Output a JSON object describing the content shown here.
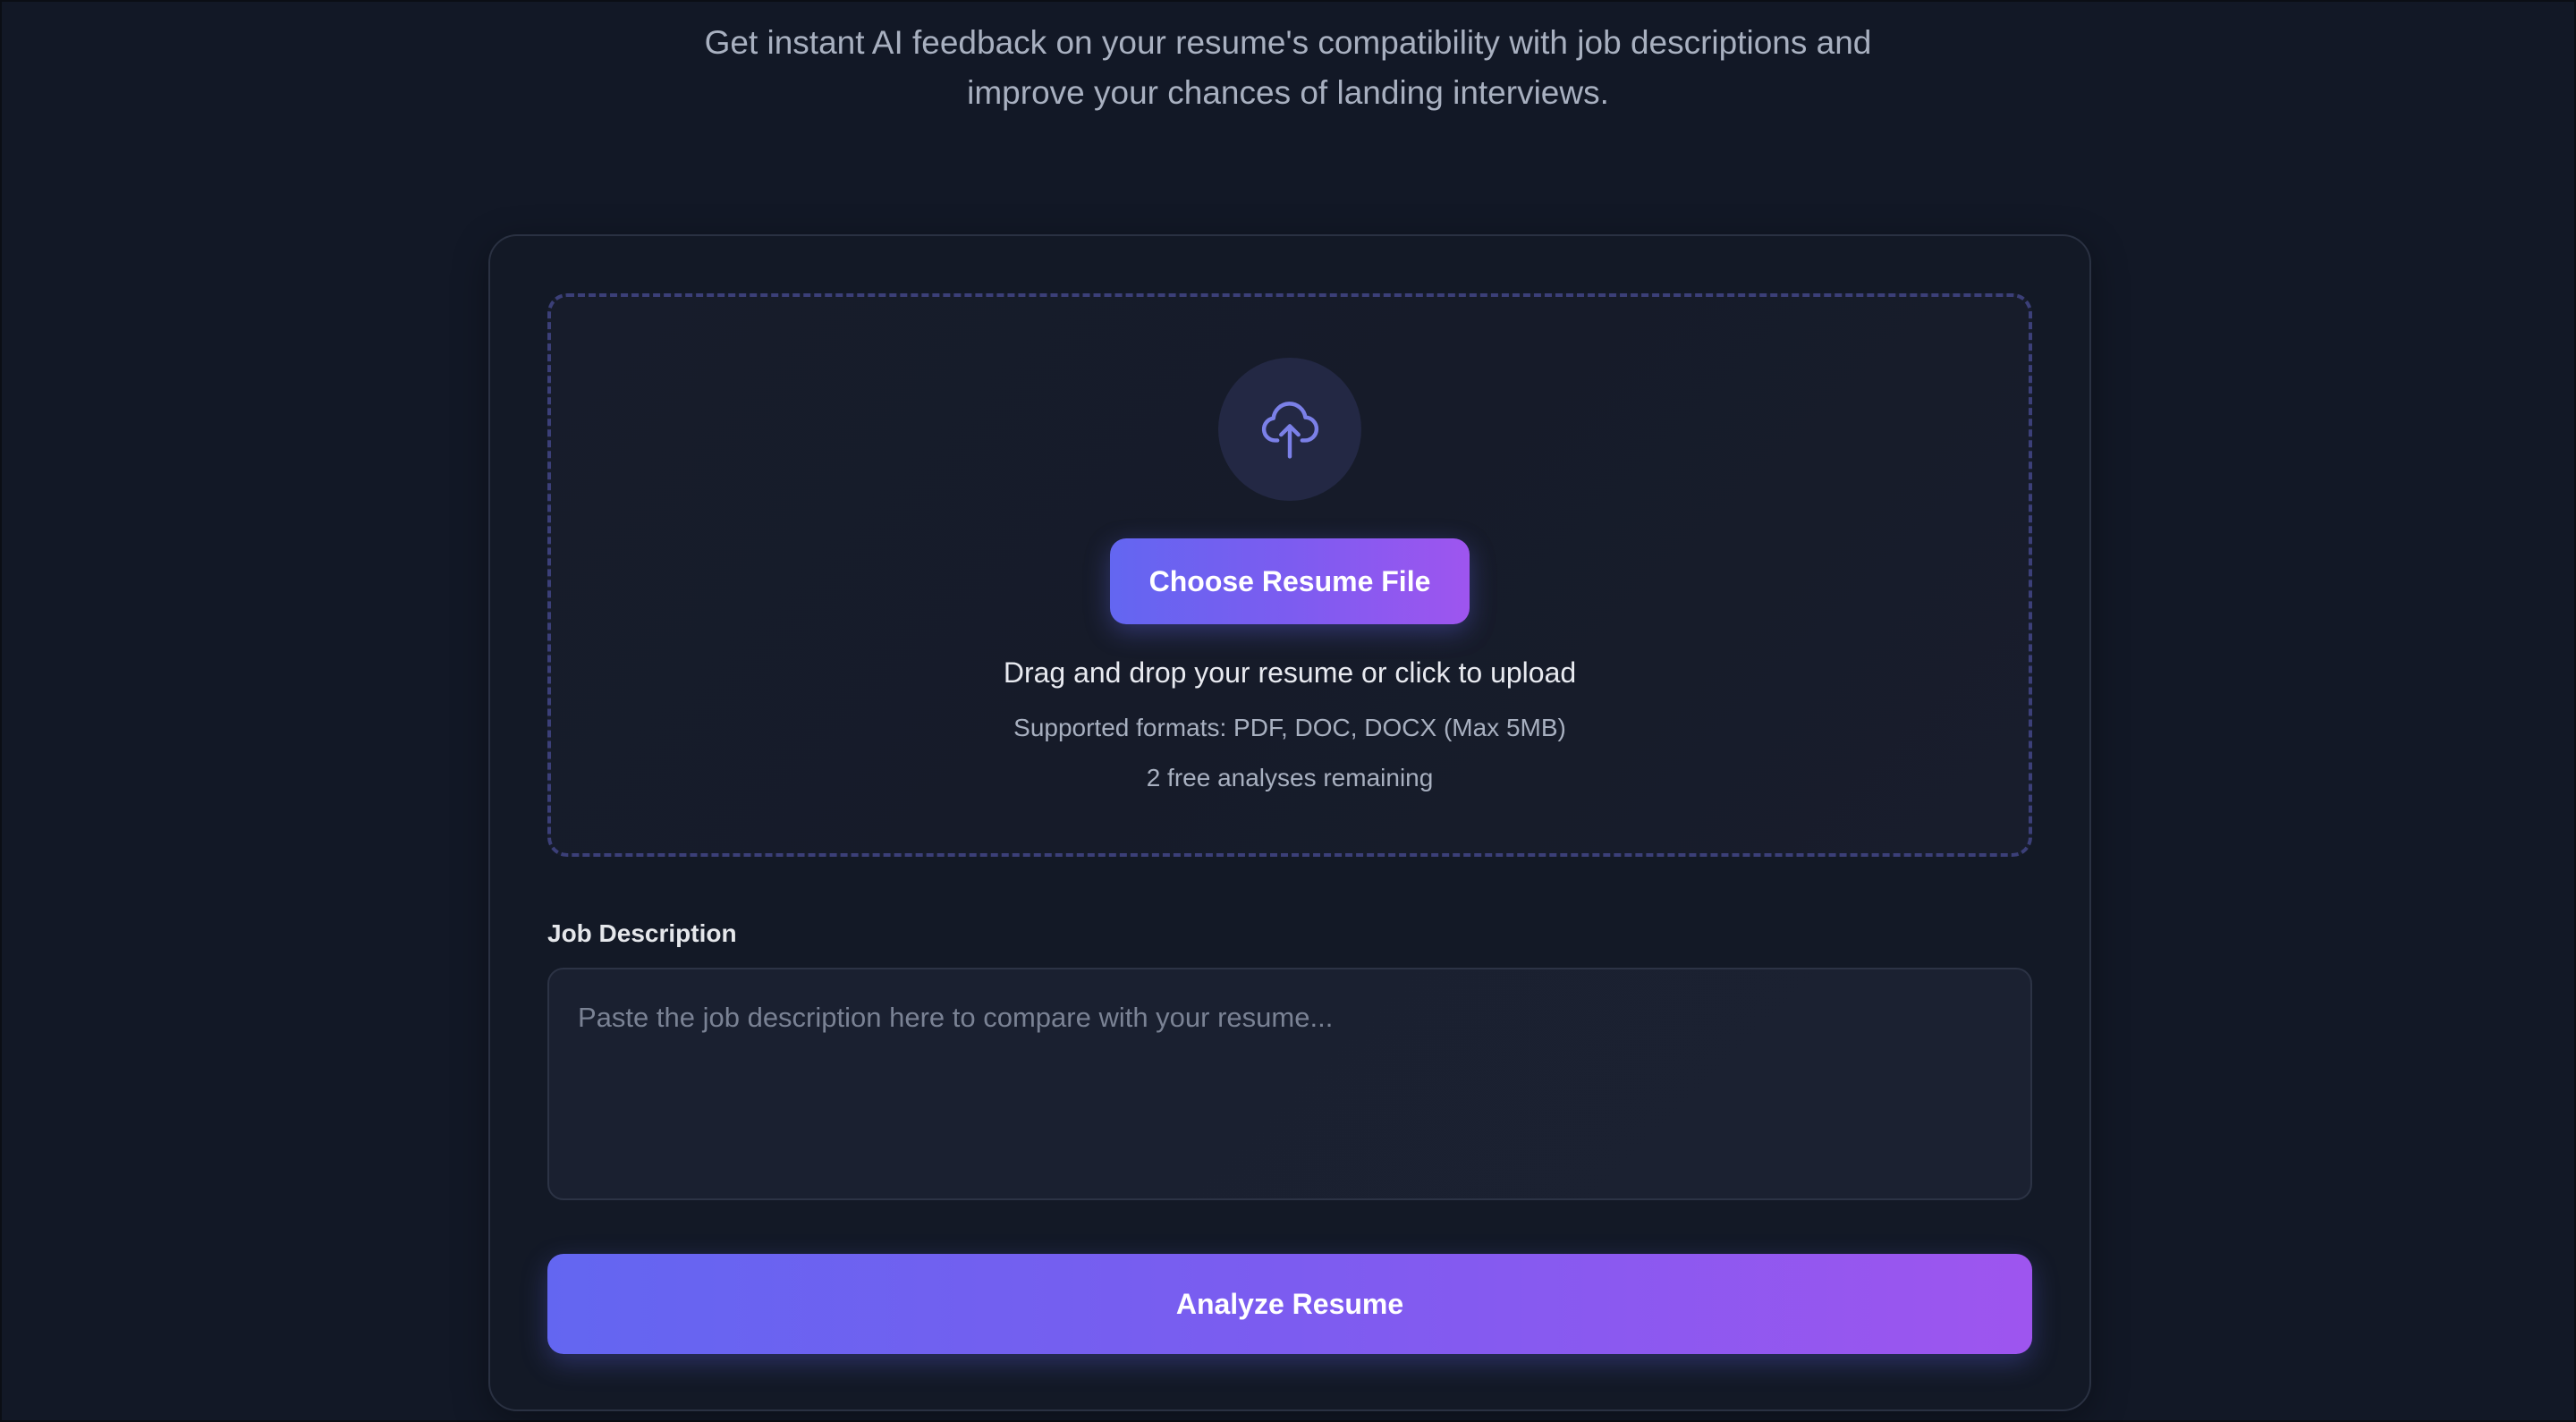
{
  "header": {
    "subtitle_line1": "Get instant AI feedback on your resume's compatibility with job descriptions and",
    "subtitle_line2": "improve your chances of landing interviews."
  },
  "upload": {
    "icon": "cloud-upload-icon",
    "choose_button_label": "Choose Resume File",
    "drop_text": "Drag and drop your resume or click to upload",
    "formats_text": "Supported formats: PDF, DOC, DOCX (Max 5MB)",
    "remaining_text": "2 free analyses remaining"
  },
  "job_description": {
    "label": "Job Description",
    "value": "",
    "placeholder": "Paste the job description here to compare with your resume..."
  },
  "analyze_button_label": "Analyze Resume",
  "colors": {
    "background": "#121826",
    "accent_start": "#6366f1",
    "accent_end": "#9e55ef",
    "icon": "#7b80e8"
  }
}
